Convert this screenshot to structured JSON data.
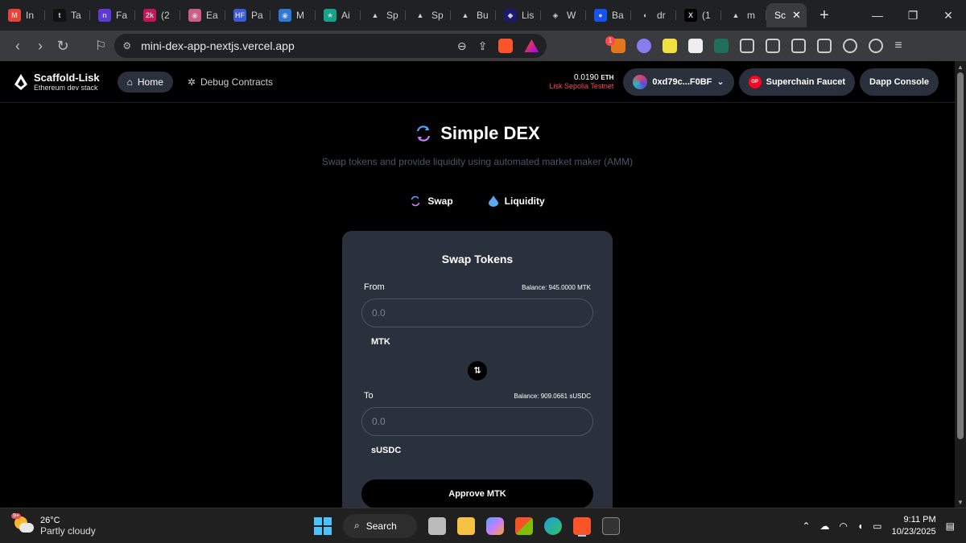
{
  "browser": {
    "tabs": [
      {
        "label": "In",
        "favicon_color": "#ea4335",
        "glyph": "M"
      },
      {
        "label": "Ta",
        "favicon_color": "#111111",
        "glyph": "t"
      },
      {
        "label": "Fa",
        "favicon_color": "#5b3bd6",
        "glyph": "n"
      },
      {
        "label": "(2",
        "favicon_color": "#c2185b",
        "glyph": "2k"
      },
      {
        "label": "Ea",
        "favicon_color": "#d05c8a",
        "glyph": "◉"
      },
      {
        "label": "Pa",
        "favicon_color": "#3b5bdb",
        "glyph": "HF"
      },
      {
        "label": "M",
        "favicon_color": "#2b7bd6",
        "glyph": "◉"
      },
      {
        "label": "Ai",
        "favicon_color": "#14a38b",
        "glyph": "★"
      },
      {
        "label": "Sp",
        "favicon_color": "#202124",
        "glyph": "▲"
      },
      {
        "label": "Sp",
        "favicon_color": "#202124",
        "glyph": "▲"
      },
      {
        "label": "Bu",
        "favicon_color": "#202124",
        "glyph": "▲"
      },
      {
        "label": "Lis",
        "favicon_color": "#1a1a6e",
        "glyph": "◆"
      },
      {
        "label": "W",
        "favicon_color": "#202124",
        "glyph": "◈"
      },
      {
        "label": "Ba",
        "favicon_color": "#1652f0",
        "glyph": "●"
      },
      {
        "label": "dr",
        "favicon_color": "#202124",
        "glyph": "◐"
      },
      {
        "label": "(1",
        "favicon_color": "#000000",
        "glyph": "X"
      },
      {
        "label": "m",
        "favicon_color": "#202124",
        "glyph": "▲"
      }
    ],
    "active_tab": {
      "label": "Sc"
    },
    "url": "mini-dex-app-nextjs.vercel.app",
    "rewards_badge": "1"
  },
  "app": {
    "brand": {
      "title": "Scaffold-Lisk",
      "subtitle": "Ethereum dev stack"
    },
    "nav": {
      "home": "Home",
      "debug": "Debug Contracts"
    },
    "wallet": {
      "balance": "0.0190",
      "unit": "ETH",
      "network": "Lisk Sepolia Testnet",
      "address": "0xd79c...F0BF",
      "faucet": "Superchain Faucet",
      "faucet_badge": "OP",
      "console": "Dapp Console"
    },
    "hero": {
      "title": "Simple DEX",
      "subtitle": "Swap tokens and provide liquidity using automated market maker (AMM)"
    },
    "tabs": {
      "swap": "Swap",
      "liquidity": "Liquidity"
    },
    "swap_card": {
      "title": "Swap Tokens",
      "from_label": "From",
      "from_balance": "Balance: 945.0000 MTK",
      "from_placeholder": "0.0",
      "from_token": "MTK",
      "to_label": "To",
      "to_balance": "Balance: 909.0661 sUSDC",
      "to_placeholder": "0.0",
      "to_token": "sUSDC",
      "approve_label": "Approve MTK"
    }
  },
  "taskbar": {
    "weather": {
      "temp": "26°C",
      "condition": "Partly cloudy",
      "badge": "9+"
    },
    "search": "Search",
    "time": "9:11 PM",
    "date": "10/23/2025"
  }
}
